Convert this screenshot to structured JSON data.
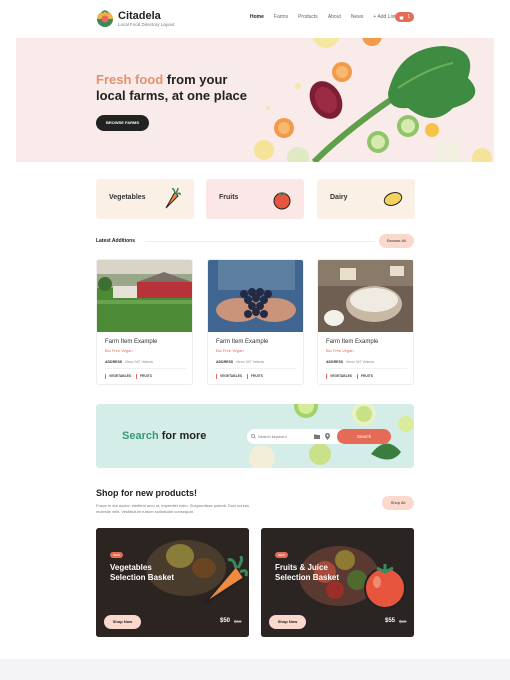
{
  "brand": {
    "name": "Citadela",
    "tagline": "Local Food Directory Layout"
  },
  "nav": {
    "items": [
      "Home",
      "Farms",
      "Products",
      "About",
      "News",
      "+ Add Listing"
    ],
    "active": "Home"
  },
  "cart": {
    "count": "1"
  },
  "hero": {
    "title_accent": "Fresh food",
    "title_rest_1": " from your",
    "title_line_2": "local farms, at one place",
    "button_label": "BROWSE FARMS"
  },
  "categories": [
    {
      "label": "Vegetables",
      "icon": "carrot-icon"
    },
    {
      "label": "Fruits",
      "icon": "tomato-icon"
    },
    {
      "label": "Dairy",
      "icon": "cheese-icon"
    }
  ],
  "latest": {
    "title": "Latest Additions",
    "browse_label": "Browse All"
  },
  "farms": [
    {
      "title": "Farm Item Example",
      "subtitle": "Bio Free Vegan",
      "address_label": "ADDRESS",
      "address": "Vienz 347 Velezia",
      "tags": [
        "VEGETABLES",
        "FRUITS"
      ],
      "image": "farm-barn-photo"
    },
    {
      "title": "Farm Item Example",
      "subtitle": "Bio Free Vegan",
      "address_label": "ADDRESS",
      "address": "Vienz 347 Velezia",
      "tags": [
        "VEGETABLES",
        "FRUITS"
      ],
      "image": "grapes-hands-photo"
    },
    {
      "title": "Farm Item Example",
      "subtitle": "Bio Free Vegan",
      "address_label": "ADDRESS",
      "address": "Vienz 347 Velezia",
      "tags": [
        "VEGETABLES",
        "FRUITS"
      ],
      "image": "dairy-flour-photo"
    }
  ],
  "search": {
    "title_accent": "Search",
    "title_rest": " for more",
    "placeholder": "Search keyword",
    "button_label": "Search"
  },
  "shop": {
    "title": "Shop for new products!",
    "description": "Fusce in dui auctor, eleifend arcu ut, imperdiet enim. Suspendisse potenti. Duis cursus molestie velit. Vestibulum rutrum sollicitudin consequat.",
    "shop_all_label": "Shop All",
    "baskets": [
      {
        "badge": "NEW",
        "title_1": "Vegetables",
        "title_2": "Selection Basket",
        "button": "Shop Now",
        "price": "$50",
        "old_price": "$60",
        "icon": "carrot-icon"
      },
      {
        "badge": "NEW",
        "title_1": "Fruits & Juice",
        "title_2": "Selection Basket",
        "button": "Shop Now",
        "price": "$55",
        "old_price": "$65",
        "icon": "tomato-icon"
      }
    ]
  },
  "colors": {
    "accent": "#e56b57",
    "peach": "#e4916d",
    "green": "#3a9a76",
    "hero_bg": "#f9ebe9"
  }
}
